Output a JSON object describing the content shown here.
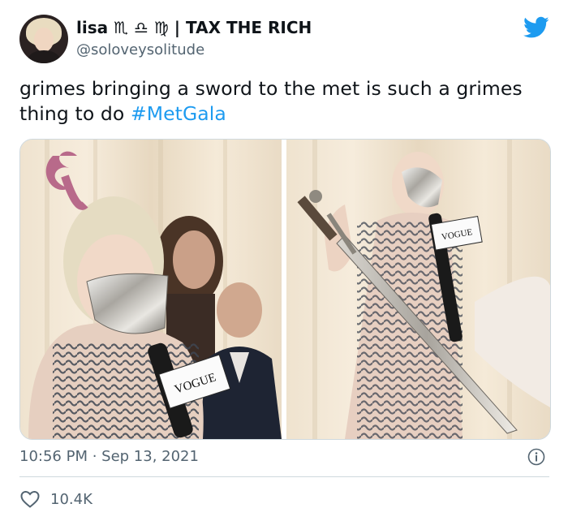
{
  "author": {
    "display_name": "lisa ♏ ♎ ♍ | TAX THE RICH",
    "handle": "@soloveysolitude"
  },
  "tweet": {
    "text_main": "grimes bringing a sword to the met is such a grimes thing to do ",
    "hashtag": "#MetGala"
  },
  "media": {
    "left_caption": "VOGUE",
    "right_caption": "VOGUE"
  },
  "meta": {
    "timestamp": "10:56 PM · Sep 13, 2021"
  },
  "engagement": {
    "likes": "10.4K"
  },
  "icons": {
    "brand": "twitter-bird-icon",
    "info": "info-icon",
    "like": "heart-icon"
  },
  "colors": {
    "brand": "#1d9bf0",
    "text": "#0f1419",
    "muted": "#536471",
    "border": "#cfd9de"
  }
}
